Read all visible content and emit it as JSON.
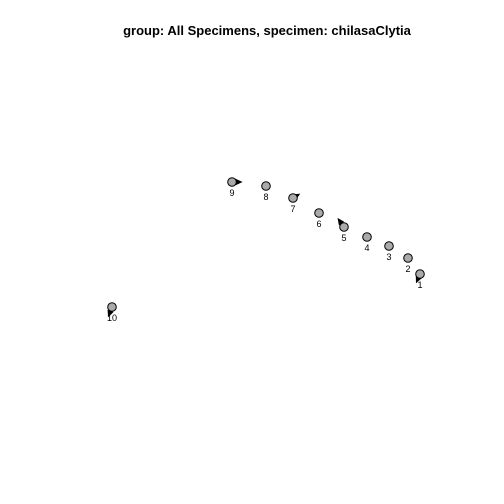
{
  "chart_data": {
    "type": "scatter",
    "title": "group: All Specimens, specimen: chilasaClytia",
    "xlabel": "",
    "ylabel": "",
    "grid": false,
    "axes_shown": false,
    "point_fill": "#aaaaaa",
    "point_stroke": "#000000",
    "arrow_color": "#000000",
    "points": [
      {
        "label": "1",
        "x": 420,
        "y": 274,
        "dx": -3,
        "dy": 7
      },
      {
        "label": "2",
        "x": 408,
        "y": 258,
        "dx": 0,
        "dy": 0
      },
      {
        "label": "3",
        "x": 389,
        "y": 246,
        "dx": 0,
        "dy": 0
      },
      {
        "label": "4",
        "x": 367,
        "y": 237,
        "dx": 0,
        "dy": 0
      },
      {
        "label": "5",
        "x": 344,
        "y": 227,
        "dx": -5,
        "dy": -7
      },
      {
        "label": "6",
        "x": 319,
        "y": 213,
        "dx": 0,
        "dy": 0
      },
      {
        "label": "7",
        "x": 293,
        "y": 198,
        "dx": 5,
        "dy": -3
      },
      {
        "label": "8",
        "x": 266,
        "y": 186,
        "dx": 0,
        "dy": 0
      },
      {
        "label": "9",
        "x": 232,
        "y": 182,
        "dx": 8,
        "dy": 0
      },
      {
        "label": "10",
        "x": 112,
        "y": 307,
        "dx": -3,
        "dy": 8
      }
    ],
    "xlim": [
      0,
      504
    ],
    "ylim": [
      504,
      0
    ]
  }
}
